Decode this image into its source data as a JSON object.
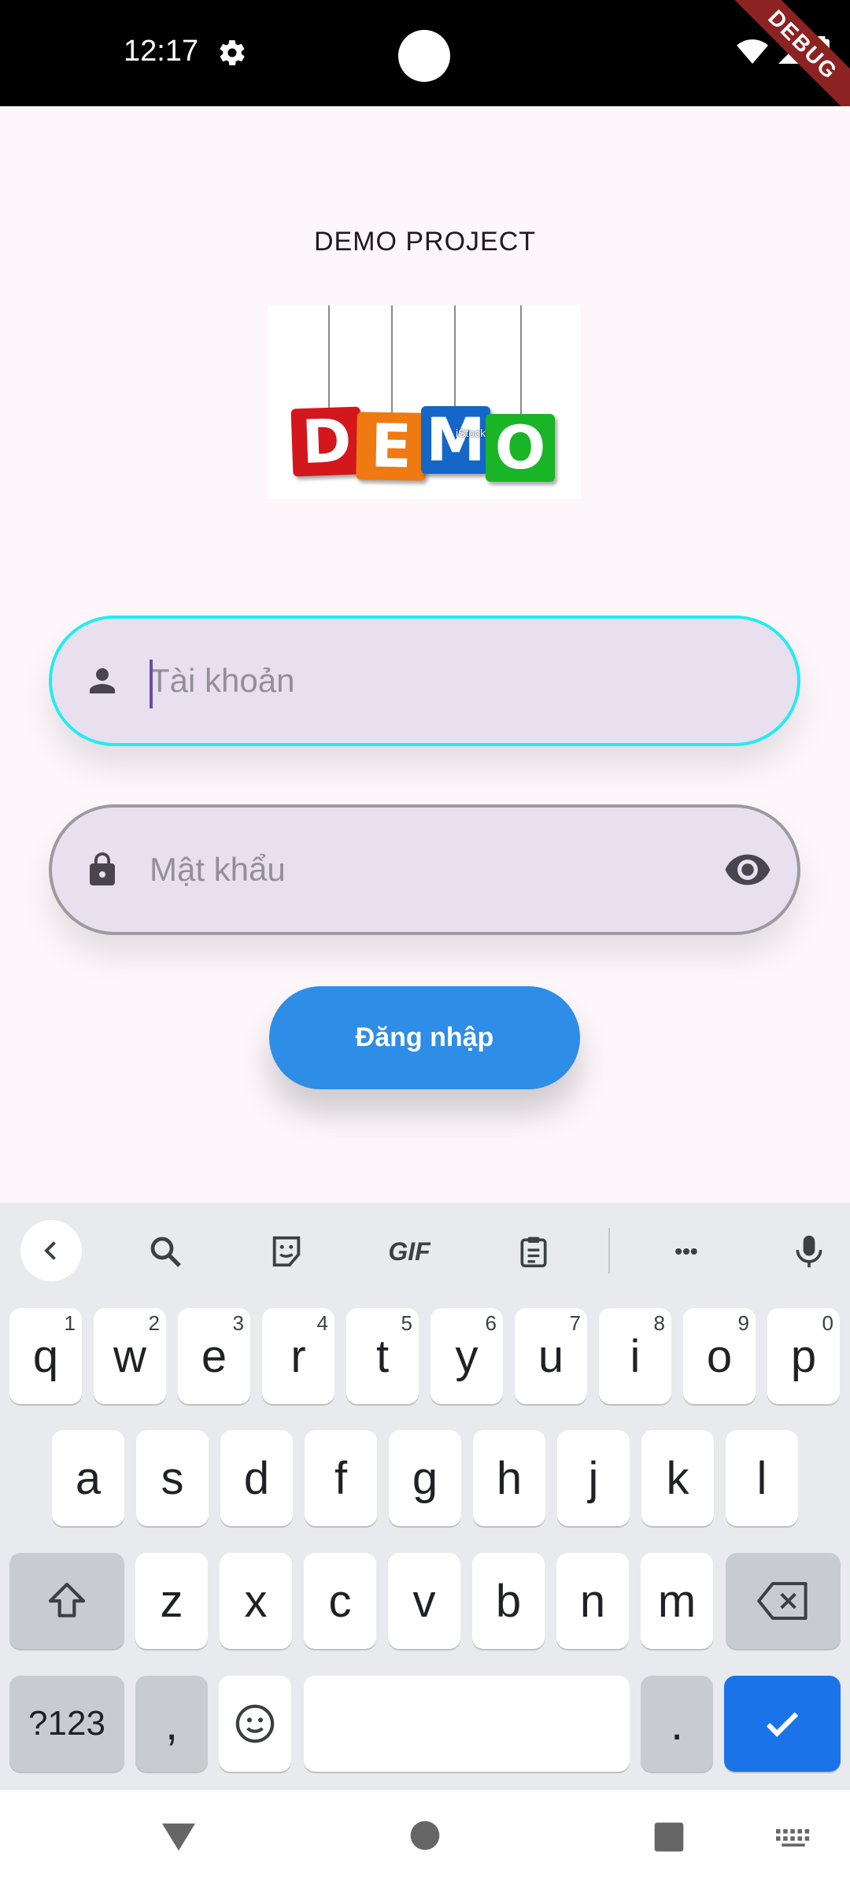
{
  "status_bar": {
    "time": "12:17",
    "debug_banner": "DEBUG"
  },
  "app": {
    "title": "DEMO PROJECT",
    "logo": {
      "letters": [
        "D",
        "E",
        "M",
        "O"
      ],
      "watermark": "iStock"
    },
    "username": {
      "placeholder": "Tài khoản",
      "value": ""
    },
    "password": {
      "placeholder": "Mật khẩu",
      "value": ""
    },
    "login_label": "Đăng nhập"
  },
  "keyboard": {
    "toolbar": [
      "back-icon",
      "search-icon",
      "sticker-icon",
      "gif-icon",
      "clipboard-icon",
      "more-icon",
      "mic-icon"
    ],
    "gif_label": "GIF",
    "more_label": "•••",
    "row1": [
      {
        "key": "q",
        "hint": "1"
      },
      {
        "key": "w",
        "hint": "2"
      },
      {
        "key": "e",
        "hint": "3"
      },
      {
        "key": "r",
        "hint": "4"
      },
      {
        "key": "t",
        "hint": "5"
      },
      {
        "key": "y",
        "hint": "6"
      },
      {
        "key": "u",
        "hint": "7"
      },
      {
        "key": "i",
        "hint": "8"
      },
      {
        "key": "o",
        "hint": "9"
      },
      {
        "key": "p",
        "hint": "0"
      }
    ],
    "row2": [
      "a",
      "s",
      "d",
      "f",
      "g",
      "h",
      "j",
      "k",
      "l"
    ],
    "row3": [
      "z",
      "x",
      "c",
      "v",
      "b",
      "n",
      "m"
    ],
    "symbols_label": "?123",
    "comma": ",",
    "period": "."
  },
  "colors": {
    "focus_border": "#22ecf2",
    "login_button": "#2e8de6",
    "keyboard_action": "#1a73e8",
    "tile_colors": [
      "#d3171d",
      "#ef7a12",
      "#1467c9",
      "#19b526"
    ]
  }
}
